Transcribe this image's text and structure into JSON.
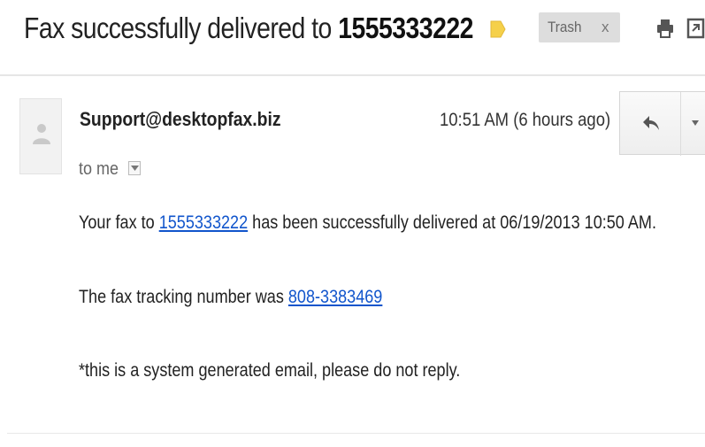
{
  "message": {
    "subject_prefix": "Fax successfully delivered to ",
    "subject_number": "1555333222",
    "labels": [
      {
        "name": "Trash",
        "remove": "x"
      }
    ]
  },
  "sender": {
    "address": "Support@desktopfax.biz",
    "recipient_text": "to me",
    "timestamp": "10:51 AM (6 hours ago)"
  },
  "body": {
    "line1_prefix": "Your fax to ",
    "line1_link": "1555333222",
    "line1_suffix": " has been successfully delivered at 06/19/2013 10:50 AM.",
    "line2_prefix": "The fax tracking number was ",
    "line2_link": "808-3383469",
    "line3": "*this is a system generated email, please do not reply."
  },
  "icons": {
    "label": "important-label-icon",
    "print": "print-icon",
    "new_window": "new-window-icon",
    "avatar": "default-avatar-icon",
    "reply": "reply-icon",
    "more": "more-options-arrow-icon",
    "details": "show-details-icon"
  },
  "colors": {
    "link": "#1155cc",
    "important_marker": "#f5d04a",
    "label_chip_bg": "#dddddd"
  }
}
